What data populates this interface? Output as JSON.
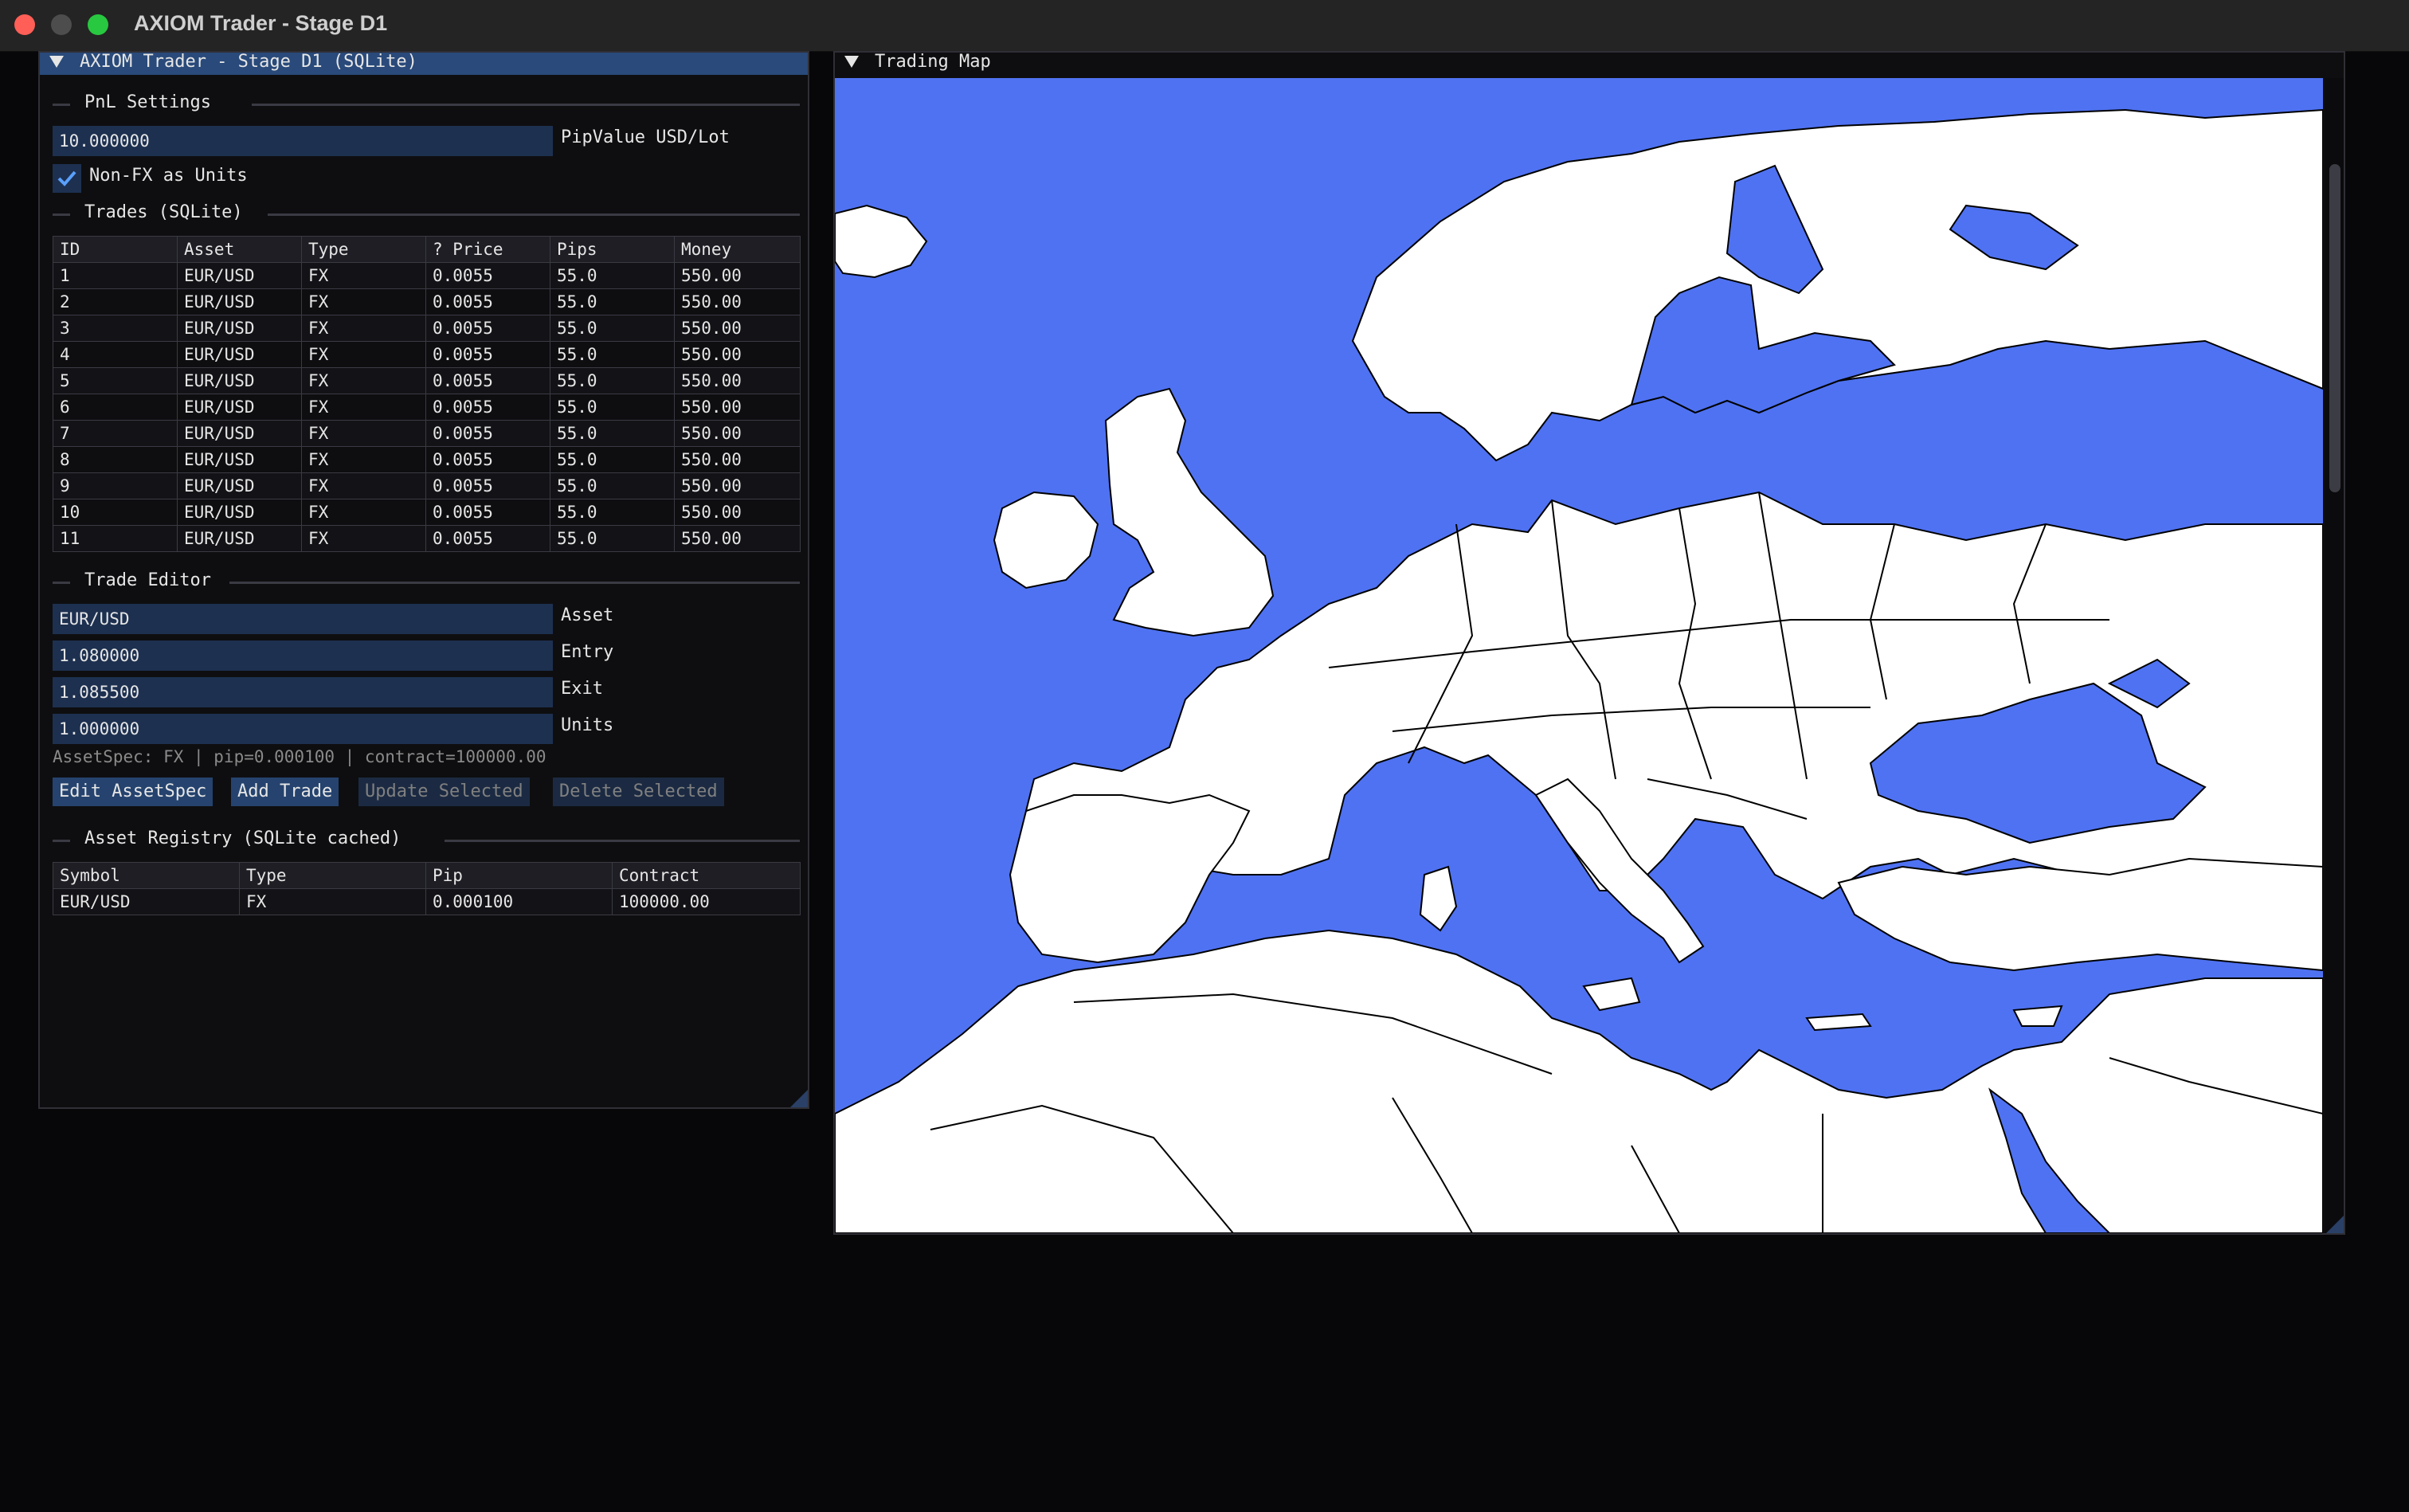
{
  "app": {
    "window_title": "AXIOM Trader - Stage D1"
  },
  "left_panel": {
    "title": "AXIOM Trader - Stage D1 (SQLite)",
    "pnl_settings": {
      "section_label": "PnL Settings",
      "pip_value": "10.000000",
      "pip_value_label": "PipValue USD/Lot",
      "non_fx_checked": true,
      "non_fx_label": "Non-FX as Units"
    },
    "trades": {
      "section_label": "Trades (SQLite)",
      "columns": [
        "ID",
        "Asset",
        "Type",
        "? Price",
        "Pips",
        "Money"
      ],
      "rows": [
        [
          "1",
          "EUR/USD",
          "FX",
          "0.0055",
          "55.0",
          "550.00"
        ],
        [
          "2",
          "EUR/USD",
          "FX",
          "0.0055",
          "55.0",
          "550.00"
        ],
        [
          "3",
          "EUR/USD",
          "FX",
          "0.0055",
          "55.0",
          "550.00"
        ],
        [
          "4",
          "EUR/USD",
          "FX",
          "0.0055",
          "55.0",
          "550.00"
        ],
        [
          "5",
          "EUR/USD",
          "FX",
          "0.0055",
          "55.0",
          "550.00"
        ],
        [
          "6",
          "EUR/USD",
          "FX",
          "0.0055",
          "55.0",
          "550.00"
        ],
        [
          "7",
          "EUR/USD",
          "FX",
          "0.0055",
          "55.0",
          "550.00"
        ],
        [
          "8",
          "EUR/USD",
          "FX",
          "0.0055",
          "55.0",
          "550.00"
        ],
        [
          "9",
          "EUR/USD",
          "FX",
          "0.0055",
          "55.0",
          "550.00"
        ],
        [
          "10",
          "EUR/USD",
          "FX",
          "0.0055",
          "55.0",
          "550.00"
        ],
        [
          "11",
          "EUR/USD",
          "FX",
          "0.0055",
          "55.0",
          "550.00"
        ]
      ]
    },
    "trade_editor": {
      "section_label": "Trade Editor",
      "asset_value": "EUR/USD",
      "asset_label": "Asset",
      "entry_value": "1.080000",
      "entry_label": "Entry",
      "exit_value": "1.085500",
      "exit_label": "Exit",
      "units_value": "1.000000",
      "units_label": "Units",
      "asset_spec": "AssetSpec: FX | pip=0.000100 | contract=100000.00",
      "buttons": {
        "edit_assetspec": "Edit AssetSpec",
        "add_trade": "Add Trade",
        "update_selected": "Update Selected",
        "delete_selected": "Delete Selected"
      }
    },
    "asset_registry": {
      "section_label": "Asset Registry (SQLite cached)",
      "columns": [
        "Symbol",
        "Type",
        "Pip",
        "Contract"
      ],
      "rows": [
        [
          "EUR/USD",
          "FX",
          "0.000100",
          "100000.00"
        ]
      ]
    }
  },
  "map_panel": {
    "title": "Trading Map",
    "colors": {
      "sea": "#4f72f2",
      "land": "#ffffff",
      "border": "#000000"
    }
  }
}
